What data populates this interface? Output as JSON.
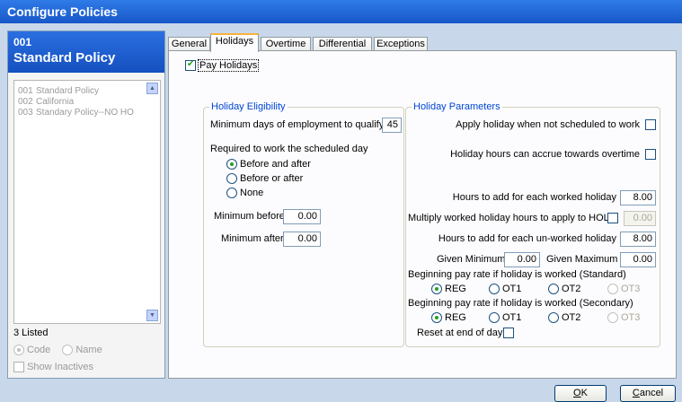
{
  "window": {
    "title": "Configure Policies"
  },
  "sidebar": {
    "selected_code": "001",
    "selected_name": "Standard Policy",
    "items": [
      {
        "code": "001",
        "name": "Standard Policy"
      },
      {
        "code": "002",
        "name": "California"
      },
      {
        "code": "003",
        "name": "Standary Policy--NO HO"
      }
    ],
    "listed_count": "3 Listed",
    "sort_code": "Code",
    "sort_name": "Name",
    "show_inactives": "Show Inactives"
  },
  "tabs": [
    "General",
    "Holidays",
    "Overtime",
    "Differential",
    "Exceptions"
  ],
  "pay_holidays": "Pay Holidays",
  "eligibility": {
    "title": "Holiday Eligibility",
    "min_days_label": "Minimum days of employment to qualify",
    "min_days_value": "45",
    "required_label": "Required to work the scheduled day",
    "options": [
      "Before and after",
      "Before or after",
      "None"
    ],
    "min_before_label": "Minimum before",
    "min_before_value": "0.00",
    "min_after_label": "Minimum after",
    "min_after_value": "0.00"
  },
  "parameters": {
    "title": "Holiday Parameters",
    "apply_not_scheduled": "Apply holiday when not scheduled to work",
    "accrue_overtime": "Holiday hours can accrue towards overtime",
    "hours_worked_label": "Hours to add for each worked holiday",
    "hours_worked_value": "8.00",
    "multiply_label": "Multiply worked holiday hours to apply to HOL",
    "multiply_value": "0.00",
    "hours_unworked_label": "Hours to add for each un-worked holiday",
    "hours_unworked_value": "8.00",
    "given_min_label": "Given Minimum",
    "given_min_value": "0.00",
    "given_max_label": "Given Maximum",
    "given_max_value": "0.00",
    "rate_standard_label": "Beginning pay rate if holiday is worked (Standard)",
    "rate_secondary_label": "Beginning pay rate if holiday is worked (Secondary)",
    "rate_options": [
      "REG",
      "OT1",
      "OT2",
      "OT3"
    ],
    "reset_label": "Reset at end of day"
  },
  "footer": {
    "ok_mnemonic": "O",
    "ok_rest": "K",
    "cancel_mnemonic": "C",
    "cancel_rest": "ancel"
  }
}
